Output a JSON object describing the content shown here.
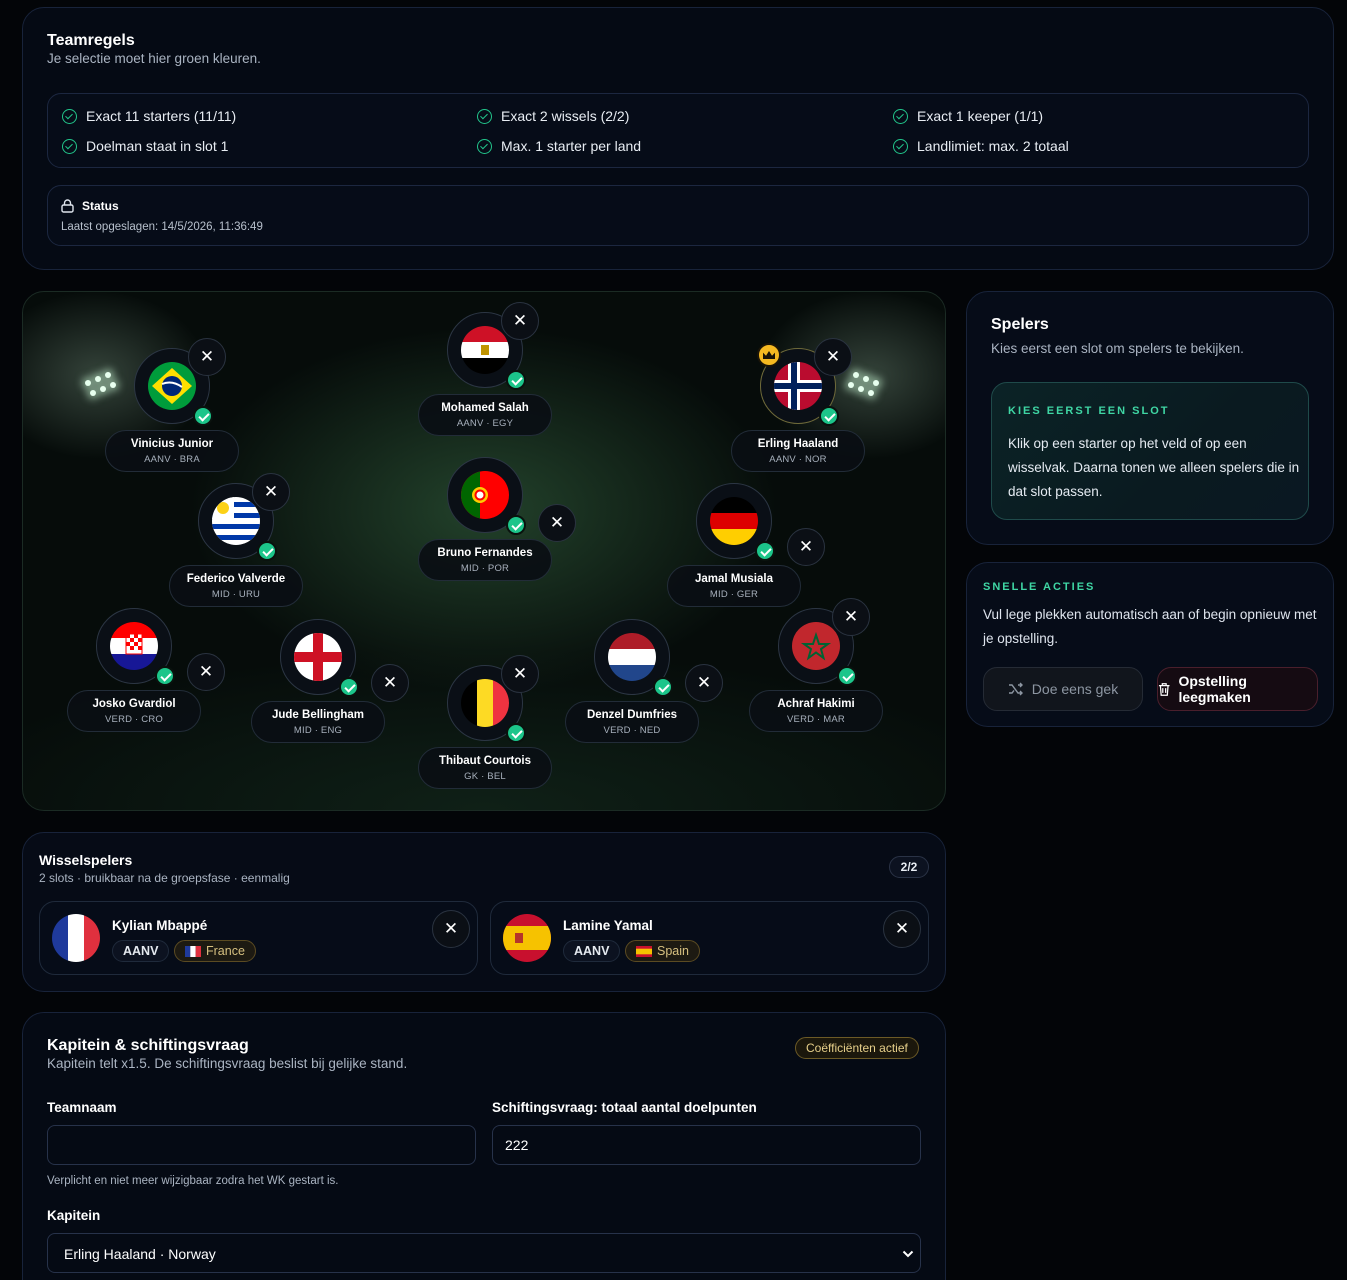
{
  "rules": {
    "title": "Teamregels",
    "subtitle": "Je selectie moet hier groen kleuren.",
    "items": [
      "Exact 11 starters (11/11)",
      "Exact 2 wissels (2/2)",
      "Exact 1 keeper (1/1)",
      "Doelman staat in slot 1",
      "Max. 1 starter per land",
      "Landlimiet: max. 2 totaal"
    ],
    "status_label": "Status",
    "status_text": "Laatst opgeslagen: 14/5/2026, 11:36:49"
  },
  "pitch": {
    "players": [
      {
        "name": "Mohamed Salah",
        "pos": "AANV · EGY",
        "flag": "EGY"
      },
      {
        "name": "Vinicius Junior",
        "pos": "AANV · BRA",
        "flag": "BRA"
      },
      {
        "name": "Erling Haaland",
        "pos": "AANV · NOR",
        "flag": "NOR",
        "captain": true
      },
      {
        "name": "Federico Valverde",
        "pos": "MID · URU",
        "flag": "URU"
      },
      {
        "name": "Bruno Fernandes",
        "pos": "MID · POR",
        "flag": "POR"
      },
      {
        "name": "Jamal Musiala",
        "pos": "MID · GER",
        "flag": "GER"
      },
      {
        "name": "Josko Gvardiol",
        "pos": "VERD · CRO",
        "flag": "CRO"
      },
      {
        "name": "Jude Bellingham",
        "pos": "MID · ENG",
        "flag": "ENG"
      },
      {
        "name": "Denzel Dumfries",
        "pos": "VERD · NED",
        "flag": "NED"
      },
      {
        "name": "Achraf Hakimi",
        "pos": "VERD · MAR",
        "flag": "MAR"
      },
      {
        "name": "Thibaut Courtois",
        "pos": "GK · BEL",
        "flag": "BEL"
      }
    ],
    "remove_glyph": "✕"
  },
  "players_panel": {
    "title": "Spelers",
    "subtitle": "Kies eerst een slot om spelers te bekijken.",
    "hint_label": "KIES EERST EEN SLOT",
    "hint_text": "Klik op een starter op het veld of op een wisselvak. Daarna tonen we alleen spelers die in dat slot passen."
  },
  "quick": {
    "label": "SNELLE ACTIES",
    "text": "Vul lege plekken automatisch aan of begin opnieuw met je opstelling.",
    "random_btn": "Doe eens gek",
    "clear_btn": "Opstelling leegmaken"
  },
  "subs": {
    "title": "Wisselspelers",
    "subtitle": "2 slots · bruikbaar na de groepsfase · eenmalig",
    "count": "2/2",
    "items": [
      {
        "name": "Kylian Mbappé",
        "pos": "AANV",
        "country": "France"
      },
      {
        "name": "Lamine Yamal",
        "pos": "AANV",
        "country": "Spain"
      }
    ]
  },
  "captain": {
    "title": "Kapitein & schiftingsvraag",
    "subtitle": "Kapitein telt x1.5. De schiftingsvraag beslist bij gelijke stand.",
    "badge": "Coëfficiënten actief",
    "team_label": "Teamnaam",
    "team_value": "",
    "team_hint": "Verplicht en niet meer wijzigbaar zodra het WK gestart is.",
    "tiebreak_label": "Schiftingsvraag: totaal aantal doelpunten",
    "tiebreak_value": "222",
    "captain_label": "Kapitein",
    "captain_value": "Erling Haaland · Norway"
  },
  "colors": {
    "accent_green": "#22c58b",
    "gold": "#f5b921",
    "danger": "#e05a6a"
  }
}
